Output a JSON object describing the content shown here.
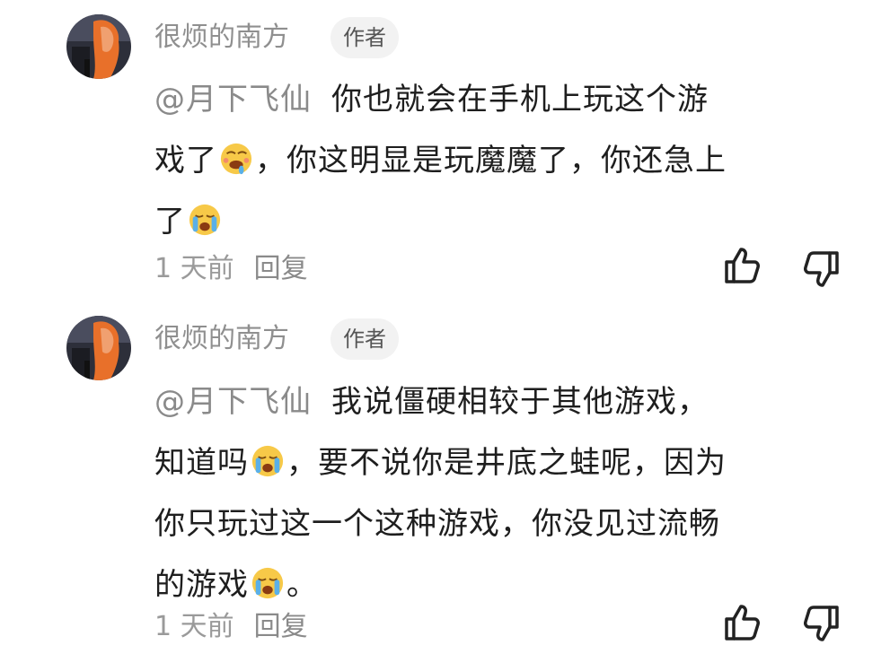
{
  "comments": [
    {
      "author": "很烦的南方",
      "badge": "作者",
      "mention": "@月下飞仙",
      "segments": [
        "你也就会在手机上玩这个游",
        "戏了",
        "，你这明显是玩魔魔了，你还急上",
        "了"
      ],
      "time": "1 天前",
      "reply": "回复"
    },
    {
      "author": "很烦的南方",
      "badge": "作者",
      "mention": "@月下飞仙",
      "segments": [
        "我说僵硬相较于其他游戏，",
        "知道吗",
        "，要不说你是井底之蛙呢，因为",
        "你只玩过这一个这种游戏，你没见过流畅",
        "的游戏",
        "。"
      ],
      "time": "1 天前",
      "reply": "回复"
    }
  ],
  "icons": {
    "like": "thumbs-up-icon",
    "dislike": "thumbs-down-icon",
    "emoji_drool": "drooling-face-emoji",
    "emoji_cry": "crying-face-emoji"
  }
}
